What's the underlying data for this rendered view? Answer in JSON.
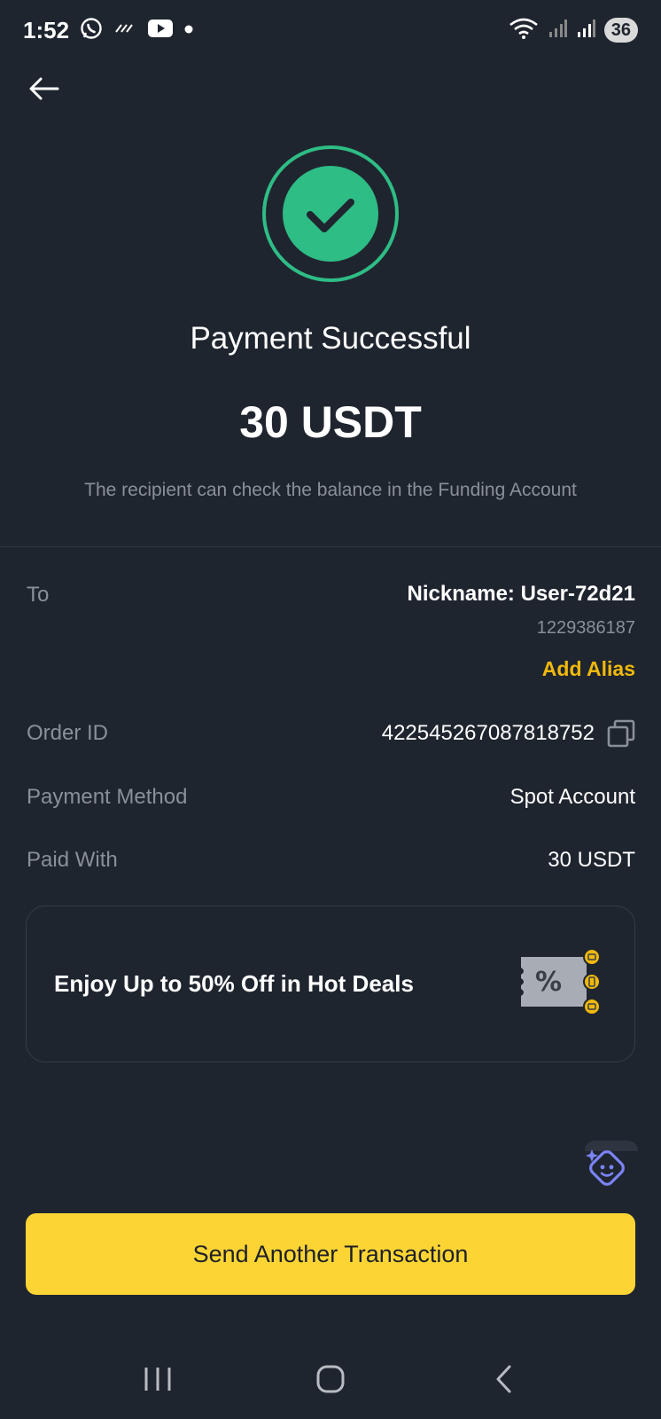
{
  "status_bar": {
    "time": "1:52",
    "battery": "36",
    "icons": [
      "whatsapp-icon",
      "missed-call-icon",
      "youtube-icon",
      "dot-icon",
      "wifi-icon",
      "signal-icon",
      "signal-icon"
    ]
  },
  "header": {
    "back_icon": "arrow-left-icon"
  },
  "result": {
    "title": "Payment Successful",
    "amount": "30 USDT",
    "note": "The recipient can check the balance in the Funding Account",
    "icon": "check-circle-icon",
    "accent_color": "#2ebd85"
  },
  "details": {
    "to_label": "To",
    "to_nickname": "Nickname: User-72d21",
    "to_id": "1229386187",
    "add_alias_label": "Add Alias",
    "order_id_label": "Order ID",
    "order_id_value": "422545267087818752",
    "payment_method_label": "Payment Method",
    "payment_method_value": "Spot Account",
    "paid_with_label": "Paid With",
    "paid_with_value": "30 USDT"
  },
  "promo": {
    "text": "Enjoy Up to 50% Off in Hot Deals",
    "icon": "discount-coupon-icon"
  },
  "assistant": {
    "icon": "assistant-bot-icon"
  },
  "actions": {
    "primary_label": "Send Another Transaction",
    "primary_color": "#fcd535"
  },
  "nav_bar": {
    "items": [
      "recent-apps-icon",
      "home-icon",
      "back-icon"
    ]
  }
}
